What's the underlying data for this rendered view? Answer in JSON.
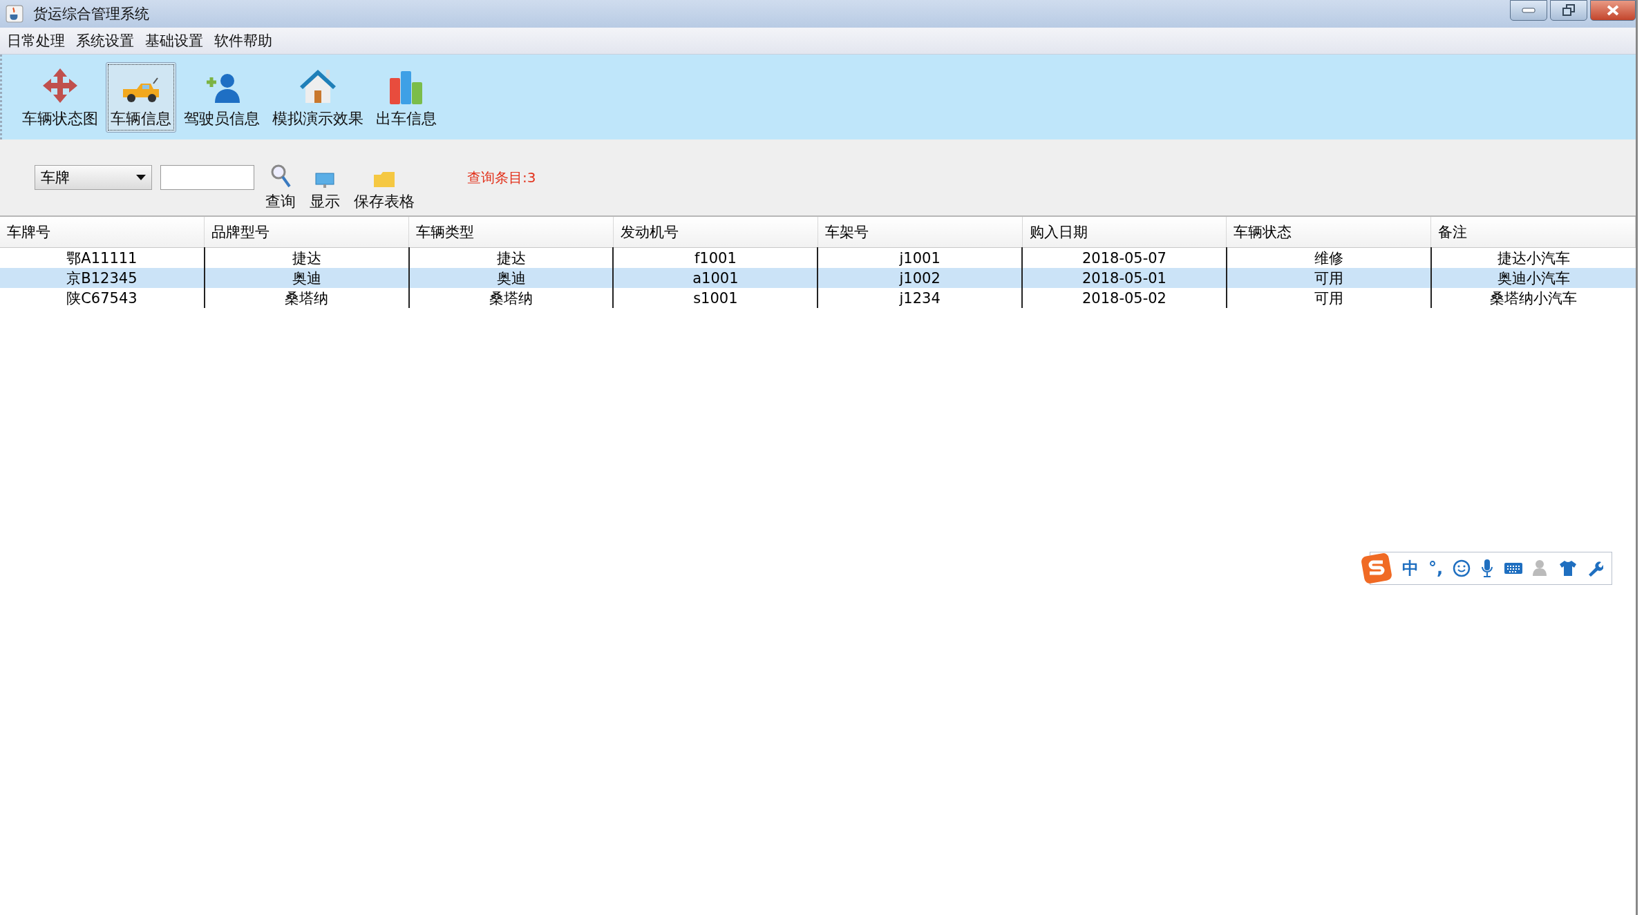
{
  "window": {
    "title": "货运综合管理系统"
  },
  "menu": [
    "日常处理",
    "系统设置",
    "基础设置",
    "软件帮助"
  ],
  "toolbar": [
    {
      "label": "车辆状态图",
      "kind": "move",
      "selected": false
    },
    {
      "label": "车辆信息",
      "kind": "truck",
      "selected": true
    },
    {
      "label": "驾驶员信息",
      "kind": "person",
      "selected": false
    },
    {
      "label": "模拟演示效果",
      "kind": "house",
      "selected": false
    },
    {
      "label": "出车信息",
      "kind": "bars",
      "selected": false
    }
  ],
  "search": {
    "field_select": "车牌",
    "actions": [
      {
        "label": "查询",
        "kind": "search"
      },
      {
        "label": "显示",
        "kind": "monitor"
      },
      {
        "label": "保存表格",
        "kind": "folder"
      }
    ],
    "result_count": "查询条目:3"
  },
  "table": {
    "columns": [
      "车牌号",
      "品牌型号",
      "车辆类型",
      "发动机号",
      "车架号",
      "购入日期",
      "车辆状态",
      "备注"
    ],
    "rows": [
      {
        "selected": false,
        "cells": [
          "鄂A11111",
          "捷达",
          "捷达",
          "f1001",
          "j1001",
          "2018-05-07",
          "维修",
          "捷达小汽车"
        ]
      },
      {
        "selected": true,
        "cells": [
          "京B12345",
          "奥迪",
          "奥迪",
          "a1001",
          "j1002",
          "2018-05-01",
          "可用",
          "奥迪小汽车"
        ]
      },
      {
        "selected": false,
        "cells": [
          "陕C67543",
          "桑塔纳",
          "桑塔纳",
          "s1001",
          "j1234",
          "2018-05-02",
          "可用",
          "桑塔纳小汽车"
        ]
      }
    ]
  },
  "ime_bar": {
    "mode": "中",
    "punctuation": "°,"
  }
}
